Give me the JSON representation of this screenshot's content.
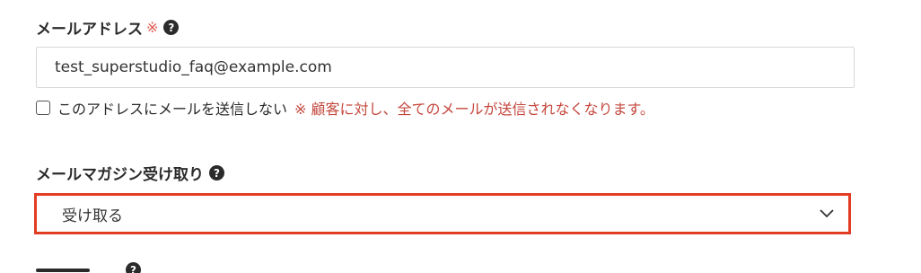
{
  "email_field": {
    "label": "メールアドレス",
    "required_mark": "※",
    "help_icon": "question-circle-icon",
    "value": "test_superstudio_faq@example.com"
  },
  "no_mail_option": {
    "checked": false,
    "label": "このアドレスにメールを送信しない",
    "warning": "※ 顧客に対し、全てのメールが送信されなくなります。"
  },
  "magazine_field": {
    "label": "メールマガジン受け取り",
    "help_icon": "question-circle-icon",
    "selected": "受け取る"
  },
  "colors": {
    "highlight_border": "#e23d24",
    "warning_text": "#c4473d",
    "required_mark": "#e05a4e"
  }
}
